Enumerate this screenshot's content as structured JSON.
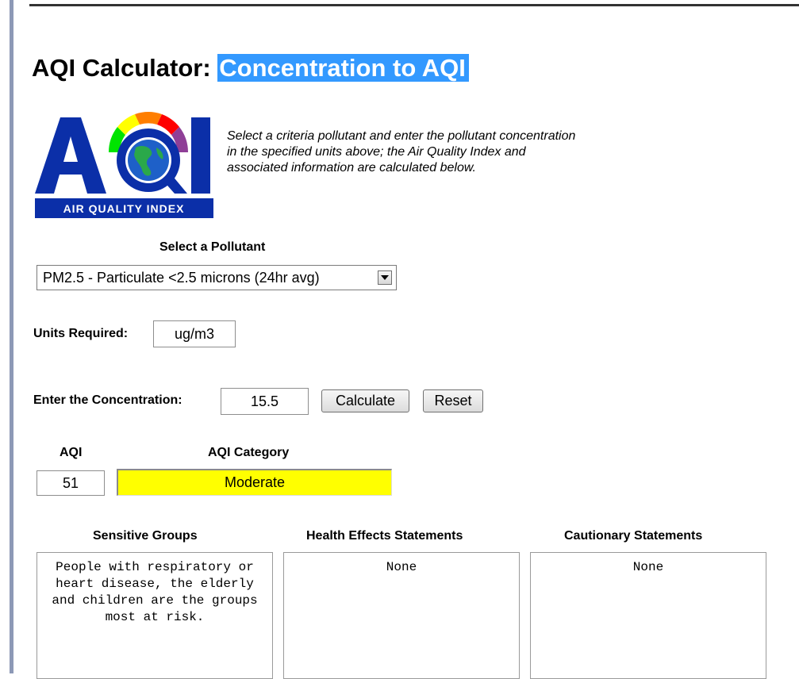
{
  "page": {
    "title_prefix": "AQI Calculator: ",
    "title_highlight": "Concentration to AQI",
    "intro": "Select a criteria pollutant and enter the pollutant concentration in the specified units above; the Air Quality Index and associated information are calculated below."
  },
  "logo": {
    "letters": "AQI",
    "caption": "AIR QUALITY INDEX",
    "colors": {
      "blue": "#0b2fa8",
      "good": "#00e400",
      "moderate": "#ffff00",
      "usg": "#ff7e00",
      "unhealthy": "#ff0000",
      "very_unhealthy": "#8f3f97"
    }
  },
  "pollutant": {
    "label": "Select a Pollutant",
    "selected": "PM2.5 - Particulate <2.5 microns (24hr avg)"
  },
  "units": {
    "label": "Units Required:",
    "value": "ug/m3"
  },
  "concentration": {
    "label": "Enter the Concentration:",
    "value": "15.5"
  },
  "buttons": {
    "calculate": "Calculate",
    "reset": "Reset"
  },
  "result": {
    "aqi_label": "AQI",
    "aqi_value": "51",
    "category_label": "AQI Category",
    "category_value": "Moderate",
    "category_color": "#ffff00"
  },
  "statements": {
    "sensitive_label": "Sensitive Groups",
    "sensitive_text": "People with respiratory or heart disease, the elderly and children are the groups most at risk.",
    "health_label": "Health Effects Statements",
    "health_text": "None",
    "cautionary_label": "Cautionary Statements",
    "cautionary_text": "None"
  }
}
